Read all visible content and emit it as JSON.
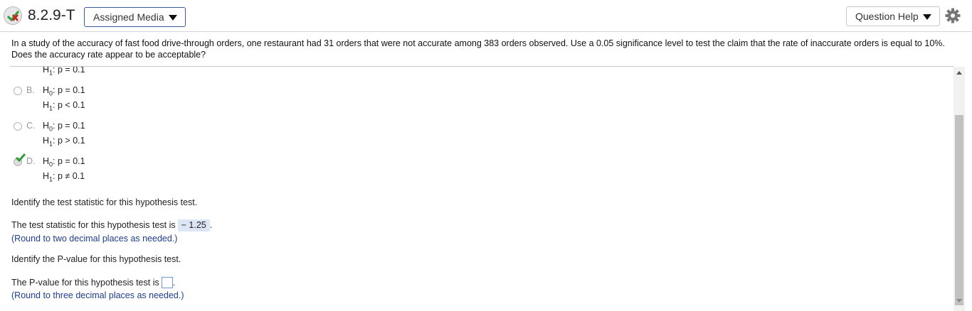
{
  "header": {
    "problem_id": "8.2.9-T",
    "assigned_media_label": "Assigned Media",
    "question_help_label": "Question Help",
    "status_icon": "partial-correct-icon",
    "settings_icon": "gear-icon"
  },
  "question": {
    "text": "In a study of the accuracy of fast food drive-through orders, one restaurant had 31 orders that were not accurate among 383 orders observed. Use a 0.05 significance level to test the claim that the rate of inaccurate orders is equal to 10%. Does the accuracy rate appear to be acceptable?"
  },
  "options": {
    "partial": {
      "h1_prefix": "H",
      "h1_sub": "1",
      "h1_rest": ": p = 0.1"
    },
    "items": [
      {
        "letter": "B.",
        "h0_prefix": "H",
        "h0_sub": "0",
        "h0_rest": ": p = 0.1",
        "h1_prefix": "H",
        "h1_sub": "1",
        "h1_rest": ": p < 0.1",
        "selected": false
      },
      {
        "letter": "C.",
        "h0_prefix": "H",
        "h0_sub": "0",
        "h0_rest": ": p = 0.1",
        "h1_prefix": "H",
        "h1_sub": "1",
        "h1_rest": ": p > 0.1",
        "selected": false
      },
      {
        "letter": "D.",
        "h0_prefix": "H",
        "h0_sub": "0",
        "h0_rest": ": p = 0.1",
        "h1_prefix": "H",
        "h1_sub": "1",
        "h1_rest": ": p ≠ 0.1",
        "selected": true
      }
    ]
  },
  "test_statistic": {
    "prompt": "Identify the test statistic for this hypothesis test.",
    "answer_prefix": "The test statistic for this hypothesis test is",
    "answer_value": "− 1.25",
    "answer_suffix": ".",
    "round_note": "(Round to two decimal places as needed.)"
  },
  "p_value": {
    "prompt": "Identify the P-value for this hypothesis test.",
    "answer_prefix": "The P-value for this hypothesis test is",
    "answer_value": "",
    "answer_suffix": ".",
    "round_note": "(Round to three decimal places as needed.)"
  }
}
